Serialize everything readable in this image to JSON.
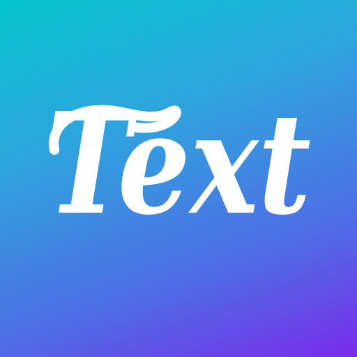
{
  "app_icon": {
    "logo_text": "Text",
    "gradient_colors": [
      "#03c4cf",
      "#2ea4de",
      "#4f6ce6",
      "#7a2ceb"
    ],
    "text_color": "#ffffff"
  }
}
